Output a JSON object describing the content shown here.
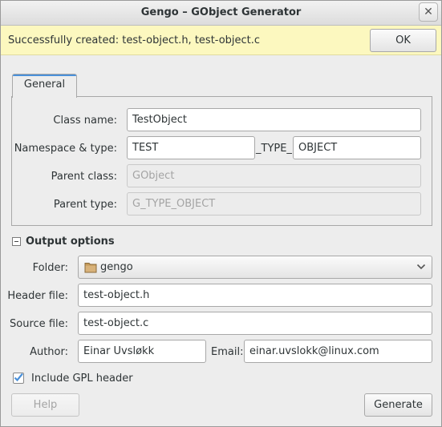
{
  "window": {
    "title": "Gengo – GObject Generator",
    "close_glyph": "✕"
  },
  "infobar": {
    "message": "Successfully created: test-object.h, test-object.c",
    "ok_label": "OK"
  },
  "tabs": [
    {
      "label": "General",
      "active": true
    }
  ],
  "general": {
    "class_name_label": "Class name:",
    "class_name_value": "TestObject",
    "namespace_label": "Namespace & type:",
    "namespace_value": "TEST",
    "type_separator": "_TYPE_",
    "type_value": "OBJECT",
    "parent_class_label": "Parent class:",
    "parent_class_placeholder": "GObject",
    "parent_type_label": "Parent type:",
    "parent_type_placeholder": "G_TYPE_OBJECT"
  },
  "output": {
    "section_label": "Output options",
    "expanded": true,
    "folder_label": "Folder:",
    "folder_value": "gengo",
    "header_label": "Header file:",
    "header_value": "test-object.h",
    "source_label": "Source file:",
    "source_value": "test-object.c",
    "author_label": "Author:",
    "author_value": "Einar Uvsløkk",
    "email_label": "Email:",
    "email_value": "einar.uvslokk@linux.com",
    "gpl_label": "Include GPL header",
    "gpl_checked": true
  },
  "footer": {
    "help_label": "Help",
    "generate_label": "Generate"
  },
  "colors": {
    "infobar_bg": "#fcf8bf",
    "tab_accent": "#4a90d9",
    "check_color": "#4a90d9",
    "folder_icon": "#c49a5a"
  },
  "icons": {
    "close": "close-icon",
    "folder": "folder-icon",
    "combo_arrow": "chevron-down-icon",
    "expander": "collapse-icon",
    "check": "checkmark-icon"
  }
}
